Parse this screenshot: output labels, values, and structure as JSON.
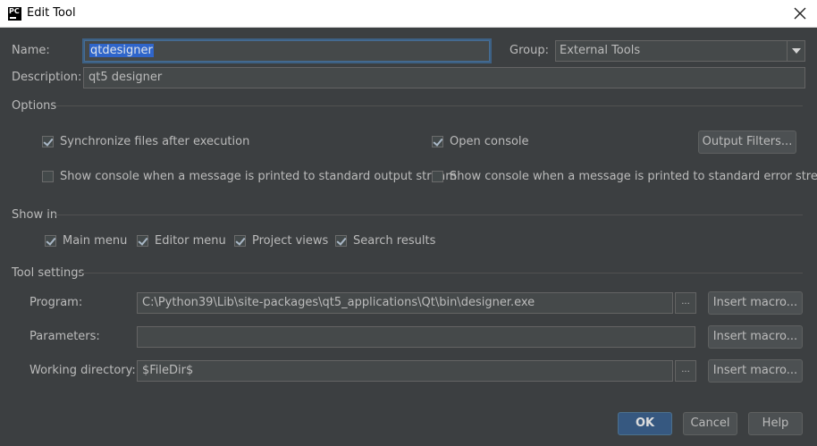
{
  "window": {
    "title": "Edit Tool",
    "app_icon_text": "PC"
  },
  "form": {
    "name_label": "Name:",
    "name_value": "qtdesigner",
    "group_label": "Group:",
    "group_value": "External Tools",
    "description_label": "Description:",
    "description_value": "qt5 designer"
  },
  "options": {
    "title": "Options",
    "sync_files": {
      "label": "Synchronize files after execution",
      "checked": true
    },
    "open_console": {
      "label": "Open console",
      "checked": true
    },
    "output_filters_button": "Output Filters...",
    "show_console_stdout": {
      "label": "Show console when a message is printed to standard output stream",
      "checked": false
    },
    "show_console_stderr": {
      "label": "Show console when a message is printed to standard error stream",
      "checked": false
    }
  },
  "show_in": {
    "title": "Show in",
    "items": [
      {
        "label": "Main menu",
        "checked": true
      },
      {
        "label": "Editor menu",
        "checked": true
      },
      {
        "label": "Project views",
        "checked": true
      },
      {
        "label": "Search results",
        "checked": true
      }
    ]
  },
  "tool_settings": {
    "title": "Tool settings",
    "program_label": "Program:",
    "program_value": "C:\\Python39\\Lib\\site-packages\\qt5_applications\\Qt\\bin\\designer.exe",
    "parameters_label": "Parameters:",
    "parameters_value": "",
    "workdir_label": "Working directory:",
    "workdir_value": "$FileDir$",
    "browse_label": "...",
    "insert_macro_label": "Insert macro..."
  },
  "footer": {
    "ok": "OK",
    "cancel": "Cancel",
    "help": "Help"
  }
}
